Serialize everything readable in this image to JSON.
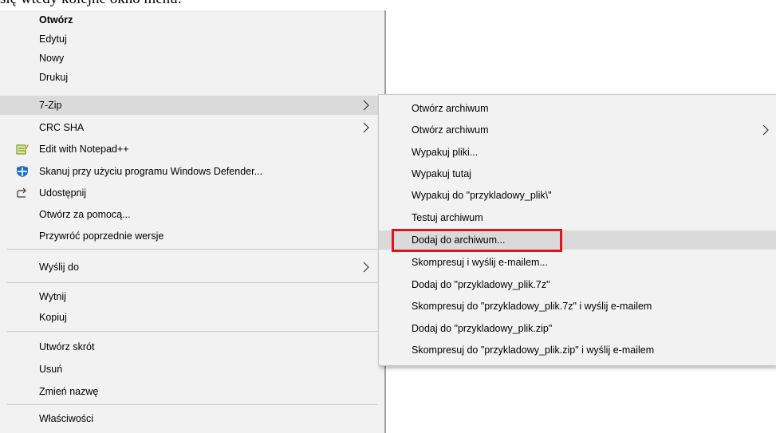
{
  "caption": "się wtedy kolejne okno menu:",
  "main_menu": {
    "items": [
      {
        "label": "Otwórz"
      },
      {
        "label": "Edytuj"
      },
      {
        "label": "Nowy"
      },
      {
        "label": "Drukuj"
      },
      {
        "label": "7-Zip"
      },
      {
        "label": "CRC SHA"
      },
      {
        "label": "Edit with Notepad++",
        "icon": "notepad-plus-plus-icon"
      },
      {
        "label": "Skanuj przy użyciu programu Windows Defender...",
        "icon": "windows-defender-shield-icon"
      },
      {
        "label": "Udostępnij",
        "icon": "share-icon"
      },
      {
        "label": "Otwórz za pomocą..."
      },
      {
        "label": "Przywróć poprzednie wersje"
      },
      {
        "label": "Wyślij do"
      },
      {
        "label": "Wytnij"
      },
      {
        "label": "Kopiuj"
      },
      {
        "label": "Utwórz skrót"
      },
      {
        "label": "Usuń"
      },
      {
        "label": "Zmień nazwę"
      },
      {
        "label": "Właściwości"
      }
    ]
  },
  "sub_menu": {
    "items": [
      {
        "label": "Otwórz archiwum"
      },
      {
        "label": "Otwórz archiwum"
      },
      {
        "label": "Wypakuj pliki..."
      },
      {
        "label": "Wypakuj tutaj"
      },
      {
        "label": "Wypakuj do \"przykladowy_plik\\\""
      },
      {
        "label": "Testuj archiwum"
      },
      {
        "label": "Dodaj do archiwum..."
      },
      {
        "label": "Skompresuj i wyślij e-mailem..."
      },
      {
        "label": "Dodaj do \"przykladowy_plik.7z\""
      },
      {
        "label": "Skompresuj do \"przykladowy_plik.7z\" i wyślij e-mailem"
      },
      {
        "label": "Dodaj do \"przykladowy_plik.zip\""
      },
      {
        "label": "Skompresuj do \"przykladowy_plik.zip\" i wyślij e-mailem"
      }
    ]
  },
  "colors": {
    "menu_bg": "#f2f2f2",
    "hover_bg": "#dadada",
    "highlight_border": "#e0141c"
  }
}
